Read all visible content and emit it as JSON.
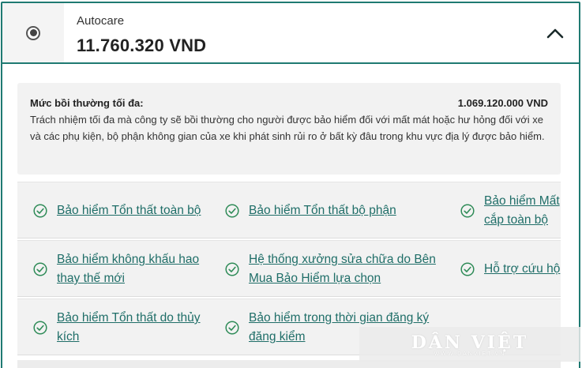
{
  "plan": {
    "name": "Autocare",
    "price": "11.760.320 VND",
    "selected": true
  },
  "coverage": {
    "label": "Mức bồi thường tối đa:",
    "amount": "1.069.120.000 VND",
    "description": "Trách nhiệm tối đa mà công ty sẽ bồi thường cho người được bảo hiểm đối với mất mát hoặc hư hỏng đối với xe và các phụ kiện, bộ phận không gian của xe khi phát sinh rủi ro ở bất kỳ đâu trong khu vực địa lý được bảo hiểm."
  },
  "benefits": [
    [
      "Bảo hiểm Tổn thất toàn bộ",
      "Bảo hiểm Tổn thất bộ phận",
      "Bảo hiểm Mất cắp toàn bộ"
    ],
    [
      "Bảo hiểm không khấu hao thay thế mới",
      "Hệ thống xưởng sửa chữa do Bên Mua Bảo Hiểm lựa chọn",
      "Hỗ trợ cứu hộ"
    ],
    [
      "Bảo hiểm Tổn thất do thủy kích",
      "Bảo hiểm trong thời gian đăng ký đăng kiểm"
    ]
  ],
  "watermark": {
    "main": "DÂN VIỆT",
    "sub": "WWW.DANVIET.VN"
  },
  "colors": {
    "accent": "#1f7a72",
    "check": "#2e8b57",
    "link": "#1f6e68"
  }
}
